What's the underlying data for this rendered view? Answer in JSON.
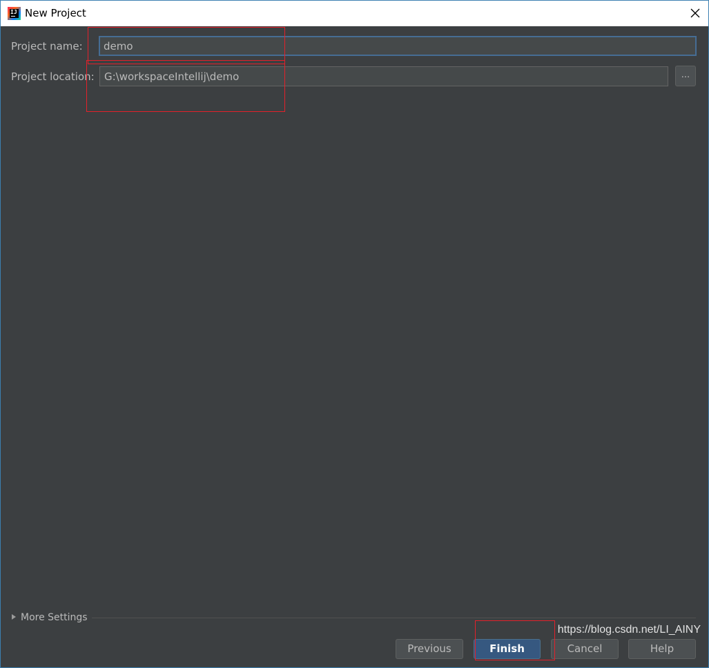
{
  "window": {
    "title": "New Project",
    "icon": "intellij-idea-icon",
    "icon_text": "IJ"
  },
  "form": {
    "name_label": "Project name:",
    "name_value": "demo",
    "location_label": "Project location:",
    "location_value": "G:\\workspaceIntellij\\demo",
    "browse_label": "..."
  },
  "more_settings": {
    "label": "More Settings",
    "expanded": false
  },
  "buttons": {
    "previous": "Previous",
    "finish": "Finish",
    "cancel": "Cancel",
    "help": "Help"
  },
  "watermark": "https://blog.csdn.net/LI_AINY",
  "colors": {
    "background": "#3c3f41",
    "text": "#bbbbbb",
    "primary_button": "#365880",
    "focus_border": "#466d94",
    "annotation": "#e5202a"
  }
}
